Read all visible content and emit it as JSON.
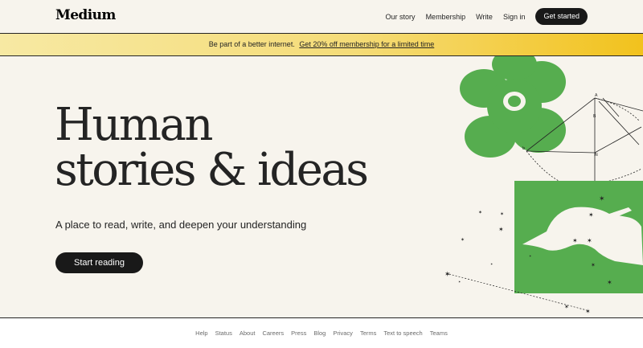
{
  "header": {
    "logo": "Medium",
    "nav": [
      {
        "label": "Our story"
      },
      {
        "label": "Membership"
      },
      {
        "label": "Write"
      },
      {
        "label": "Sign in"
      }
    ],
    "cta": "Get started"
  },
  "banner": {
    "text": "Be part of a better internet.",
    "link": "Get 20% off membership for a limited time"
  },
  "hero": {
    "headline_line1": "Human",
    "headline_line2": "stories & ideas",
    "subtitle": "A place to read, write, and deepen your understanding",
    "button": "Start reading"
  },
  "footer": {
    "links": [
      "Help",
      "Status",
      "About",
      "Careers",
      "Press",
      "Blog",
      "Privacy",
      "Terms",
      "Text to speech",
      "Teams"
    ]
  },
  "colors": {
    "background": "#f7f4ed",
    "text": "#242424",
    "button": "#191919",
    "accent_green": "#56ad4f",
    "banner_yellow": "#f2c21d"
  }
}
